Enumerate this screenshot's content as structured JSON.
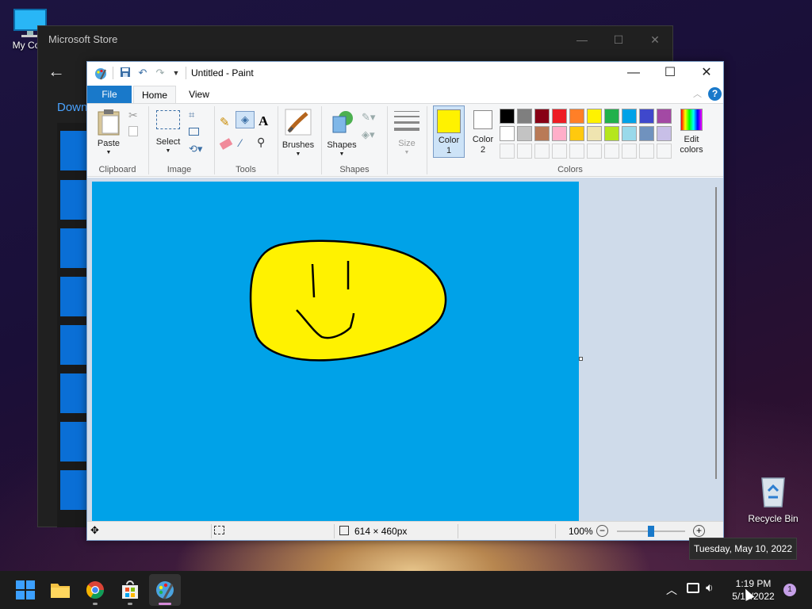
{
  "desktop": {
    "icons": [
      {
        "label": "My Com"
      },
      {
        "label": "Recycle Bin"
      }
    ]
  },
  "store": {
    "title": "Microsoft Store",
    "sidebar_heading": "Down"
  },
  "paint": {
    "title": "Untitled - Paint",
    "tabs": {
      "file": "File",
      "home": "Home",
      "view": "View"
    },
    "groups": {
      "clipboard": "Clipboard",
      "image": "Image",
      "tools": "Tools",
      "shapes": "Shapes",
      "colors": "Colors"
    },
    "buttons": {
      "paste": "Paste",
      "select": "Select",
      "brushes": "Brushes",
      "shapes": "Shapes",
      "size": "Size",
      "color1": "Color\n1",
      "color2": "Color\n2",
      "edit_colors": "Edit\ncolors"
    },
    "color1_value": "#fff200",
    "color2_value": "#ffffff",
    "palette": [
      "#000000",
      "#7f7f7f",
      "#880015",
      "#ed1c24",
      "#ff7f27",
      "#fff200",
      "#22b14c",
      "#00a2e8",
      "#3f48cc",
      "#a349a4",
      "#ffffff",
      "#c3c3c3",
      "#b97a57",
      "#ffaec9",
      "#ffc90e",
      "#efe4b0",
      "#b5e61d",
      "#99d9ea",
      "#7092be",
      "#c8bfe7"
    ],
    "canvas_color": "#00a2e8",
    "status": {
      "dimensions": "614 × 460px",
      "zoom": "100%"
    },
    "zoom_level": 1.0
  },
  "taskbar": {
    "time": "1:19 PM",
    "date": "5/10/2022",
    "notification_count": "1"
  },
  "tooltip": "Tuesday, May 10, 2022"
}
